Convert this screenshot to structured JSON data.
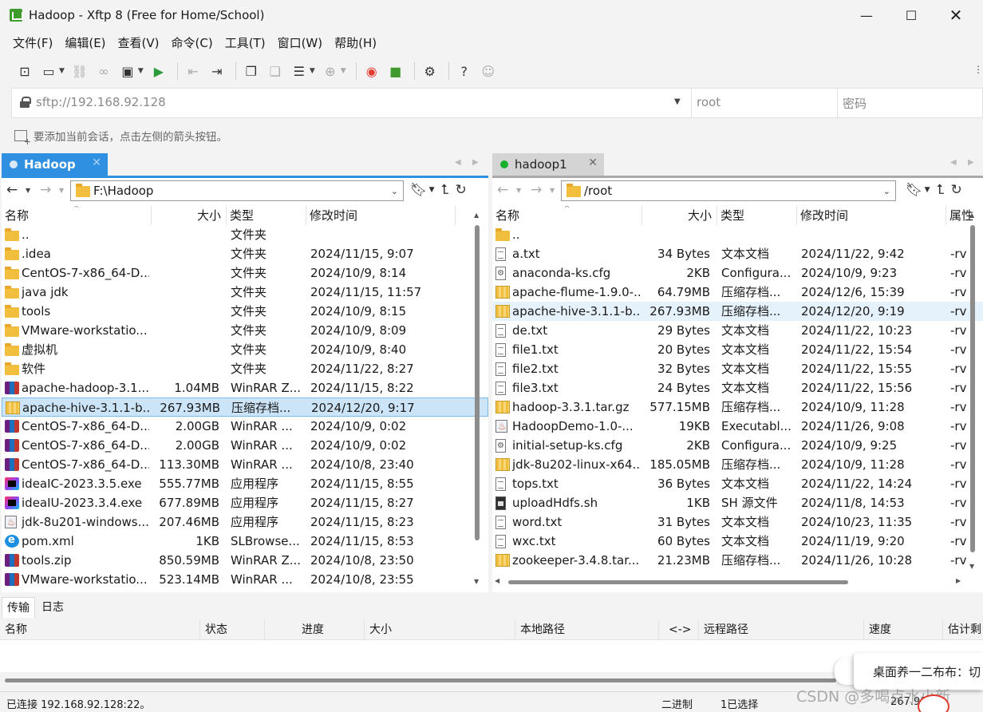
{
  "window": {
    "title": "Hadoop - Xftp 8 (Free for Home/School)",
    "minimize": "—",
    "maximize": "☐",
    "close": "✕"
  },
  "menu": [
    "文件(F)",
    "编辑(E)",
    "查看(V)",
    "命令(C)",
    "工具(T)",
    "窗口(W)",
    "帮助(H)"
  ],
  "address": {
    "url": "sftp://192.168.92.128",
    "user_placeholder": "root",
    "password_placeholder": "密码"
  },
  "hint": "要添加当前会话，点击左侧的箭头按钮。",
  "left": {
    "tab_label": "Hadoop",
    "path": "F:\\Hadoop",
    "columns": [
      "名称",
      "大小",
      "类型",
      "修改时间"
    ],
    "rows": [
      {
        "icon": "folder",
        "name": "..",
        "size": "",
        "type": "文件夹",
        "modified": ""
      },
      {
        "icon": "folder",
        "name": ".idea",
        "size": "",
        "type": "文件夹",
        "modified": "2024/11/15, 9:07"
      },
      {
        "icon": "folder",
        "name": "CentOS-7-x86_64-D...",
        "size": "",
        "type": "文件夹",
        "modified": "2024/10/9, 8:14"
      },
      {
        "icon": "folder",
        "name": "java jdk",
        "size": "",
        "type": "文件夹",
        "modified": "2024/11/15, 11:57"
      },
      {
        "icon": "folder",
        "name": "tools",
        "size": "",
        "type": "文件夹",
        "modified": "2024/10/9, 8:15"
      },
      {
        "icon": "folder",
        "name": "VMware-workstatio...",
        "size": "",
        "type": "文件夹",
        "modified": "2024/10/9, 8:09"
      },
      {
        "icon": "folder",
        "name": "虚拟机",
        "size": "",
        "type": "文件夹",
        "modified": "2024/10/9, 8:40"
      },
      {
        "icon": "folder",
        "name": "软件",
        "size": "",
        "type": "文件夹",
        "modified": "2024/11/22, 8:27"
      },
      {
        "icon": "rar",
        "name": "apache-hadoop-3.1....",
        "size": "1.04MB",
        "type": "WinRAR Z...",
        "modified": "2024/11/15, 8:22"
      },
      {
        "icon": "zip",
        "name": "apache-hive-3.1.1-b...",
        "size": "267.93MB",
        "type": "压缩存档...",
        "modified": "2024/12/20, 9:17",
        "selected": true
      },
      {
        "icon": "rar",
        "name": "CentOS-7-x86_64-D...",
        "size": "2.00GB",
        "type": "WinRAR ...",
        "modified": "2024/10/9, 0:02"
      },
      {
        "icon": "rar",
        "name": "CentOS-7-x86_64-D...",
        "size": "2.00GB",
        "type": "WinRAR ...",
        "modified": "2024/10/9, 0:02"
      },
      {
        "icon": "rar",
        "name": "CentOS-7-x86_64-D...",
        "size": "113.30MB",
        "type": "WinRAR ...",
        "modified": "2024/10/8, 23:40"
      },
      {
        "icon": "idea",
        "name": "ideaIC-2023.3.5.exe",
        "size": "555.77MB",
        "type": "应用程序",
        "modified": "2024/11/15, 8:55"
      },
      {
        "icon": "idea",
        "name": "ideaIU-2023.3.4.exe",
        "size": "677.89MB",
        "type": "应用程序",
        "modified": "2024/11/15, 8:27"
      },
      {
        "icon": "java",
        "name": "jdk-8u201-windows...",
        "size": "207.46MB",
        "type": "应用程序",
        "modified": "2024/11/15, 8:23"
      },
      {
        "icon": "xml",
        "name": "pom.xml",
        "size": "1KB",
        "type": "SLBrowse...",
        "modified": "2024/11/15, 8:53"
      },
      {
        "icon": "rar",
        "name": "tools.zip",
        "size": "850.59MB",
        "type": "WinRAR Z...",
        "modified": "2024/10/8, 23:50"
      },
      {
        "icon": "rar",
        "name": "VMware-workstatio...",
        "size": "523.14MB",
        "type": "WinRAR ...",
        "modified": "2024/10/8, 23:55"
      }
    ]
  },
  "right": {
    "tab_label": "hadoop1",
    "path": "/root",
    "columns": [
      "名称",
      "大小",
      "类型",
      "修改时间",
      "属性"
    ],
    "rows": [
      {
        "icon": "folder",
        "name": "..",
        "size": "",
        "type": "",
        "modified": "",
        "attr": ""
      },
      {
        "icon": "txt",
        "name": "a.txt",
        "size": "34 Bytes",
        "type": "文本文档",
        "modified": "2024/11/22, 9:42",
        "attr": "-rv"
      },
      {
        "icon": "cfg",
        "name": "anaconda-ks.cfg",
        "size": "2KB",
        "type": "Configura...",
        "modified": "2024/10/9, 9:23",
        "attr": "-rv"
      },
      {
        "icon": "zip",
        "name": "apache-flume-1.9.0-...",
        "size": "64.79MB",
        "type": "压缩存档...",
        "modified": "2024/12/6, 15:39",
        "attr": "-rv"
      },
      {
        "icon": "zip",
        "name": "apache-hive-3.1.1-b...",
        "size": "267.93MB",
        "type": "压缩存档...",
        "modified": "2024/12/20, 9:19",
        "attr": "-rv",
        "hover": true
      },
      {
        "icon": "txt",
        "name": "de.txt",
        "size": "29 Bytes",
        "type": "文本文档",
        "modified": "2024/11/22, 10:23",
        "attr": "-rv"
      },
      {
        "icon": "txt",
        "name": "file1.txt",
        "size": "20 Bytes",
        "type": "文本文档",
        "modified": "2024/11/22, 15:54",
        "attr": "-rv"
      },
      {
        "icon": "txt",
        "name": "file2.txt",
        "size": "32 Bytes",
        "type": "文本文档",
        "modified": "2024/11/22, 15:55",
        "attr": "-rv"
      },
      {
        "icon": "txt",
        "name": "file3.txt",
        "size": "24 Bytes",
        "type": "文本文档",
        "modified": "2024/11/22, 15:56",
        "attr": "-rv"
      },
      {
        "icon": "zip",
        "name": "hadoop-3.3.1.tar.gz",
        "size": "577.15MB",
        "type": "压缩存档...",
        "modified": "2024/10/9, 11:28",
        "attr": "-rv"
      },
      {
        "icon": "java",
        "name": "HadoopDemo-1.0-...",
        "size": "19KB",
        "type": "Executabl...",
        "modified": "2024/11/26, 9:08",
        "attr": "-rv"
      },
      {
        "icon": "cfg",
        "name": "initial-setup-ks.cfg",
        "size": "2KB",
        "type": "Configura...",
        "modified": "2024/10/9, 9:25",
        "attr": "-rv"
      },
      {
        "icon": "zip",
        "name": "jdk-8u202-linux-x64...",
        "size": "185.05MB",
        "type": "压缩存档...",
        "modified": "2024/10/9, 11:28",
        "attr": "-rv"
      },
      {
        "icon": "txt",
        "name": "tops.txt",
        "size": "36 Bytes",
        "type": "文本文档",
        "modified": "2024/11/22, 14:24",
        "attr": "-rv"
      },
      {
        "icon": "sh",
        "name": "uploadHdfs.sh",
        "size": "1KB",
        "type": "SH 源文件",
        "modified": "2024/11/8, 14:53",
        "attr": "-rv"
      },
      {
        "icon": "txt",
        "name": "word.txt",
        "size": "31 Bytes",
        "type": "文本文档",
        "modified": "2024/10/23, 11:35",
        "attr": "-rv"
      },
      {
        "icon": "txt",
        "name": "wxc.txt",
        "size": "60 Bytes",
        "type": "文本文档",
        "modified": "2024/11/19, 9:20",
        "attr": "-rv"
      },
      {
        "icon": "zip",
        "name": "zookeeper-3.4.8.tar....",
        "size": "21.23MB",
        "type": "压缩存档...",
        "modified": "2024/11/26, 10:28",
        "attr": "-rv"
      }
    ]
  },
  "bottom": {
    "tabs": [
      "传输",
      "日志"
    ],
    "columns": [
      "名称",
      "状态",
      "进度",
      "大小",
      "本地路径",
      "<->",
      "远程路径",
      "速度",
      "估计剩"
    ]
  },
  "status": {
    "connection": "已连接 192.168.92.128:22。",
    "mode": "二进制",
    "selected": "1已选择",
    "size": "267.93"
  },
  "overlay": {
    "notification": "桌面养一二布布：切",
    "watermark": "CSDN @多喝点水小新"
  }
}
